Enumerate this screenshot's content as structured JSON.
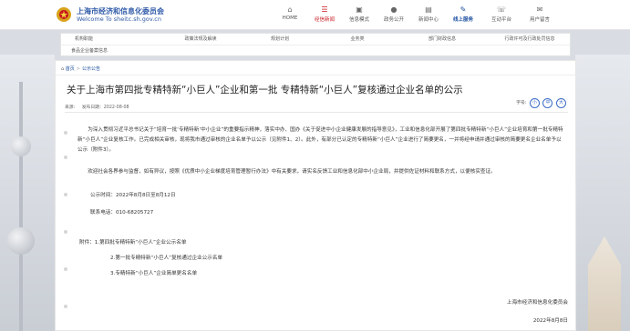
{
  "header": {
    "org_name": "上海市经济和信息化委员会",
    "org_sub": "Welcome To sheitc.sh.gov.cn",
    "nav": [
      {
        "label": "HOME",
        "icon": "home-icon",
        "glyph": "⌂"
      },
      {
        "label": "经信新闻",
        "icon": "news-icon",
        "glyph": "☰"
      },
      {
        "label": "信息模式",
        "icon": "info-icon",
        "glyph": "▣"
      },
      {
        "label": "政务公开",
        "icon": "gov-icon",
        "glyph": "●"
      },
      {
        "label": "新闻中心",
        "icon": "media-icon",
        "glyph": "▤"
      },
      {
        "label": "线上服务",
        "icon": "service-icon",
        "glyph": "✎"
      },
      {
        "label": "互动平台",
        "icon": "chat-icon",
        "glyph": "☏"
      },
      {
        "label": "用户留言",
        "icon": "message-icon",
        "glyph": "✉"
      }
    ]
  },
  "subnav": {
    "row1": [
      "机构职能",
      "政策法规及解读",
      "规划计划",
      "业务类",
      "部门财政信息",
      "行政许可及行政处罚信息"
    ],
    "row2": [
      "食品企业备案信息"
    ]
  },
  "breadcrumb": {
    "home": "首页",
    "sep": ">",
    "current": "公示公告"
  },
  "article": {
    "title": "关于上海市第四批专精特新“小巨人”企业和第一批 专精特新“小巨人”复核通过企业名单的公示",
    "source_label": "来源:",
    "date_label": "发布日期：2022-08-08",
    "fontsize_label": "字号:",
    "fontsize_small": "小",
    "fontsize_mid": "中",
    "fontsize_big": "大",
    "p1": "为深入贯彻习近平总书记关于“培育一批‘专精特新’中小企业”的重要指示精神，落实中办、国办《关于促进中小企业健康发展的指导意见》，工业和信息化部开展了第四批专精特新“小巨人”企业培育和第一批专精特新“小巨人”企业复核工作。已完成相关审核，现将我市通过审核的企业名单予以公示（见附件1、2）。此外，有部分已认定的专精特新“小巨人”企业进行了简要更名，一并将经申请并通过审核的简要更名企业名单予以公示（附件3）。",
    "p2": "欢迎社会各界参与监督，如有异议，按照《优质中小企业梯度培育管理暂行办法》中有关要求，请实名反馈工业和信息化部中小企业局，并提供佐证材料和联系方式，以便核实查证。",
    "time_line": "公示时间：2022年8月8日至8月12日",
    "phone_line": "联系电话：010-68205727",
    "attach1": "附件：1.第四批专精特新“小巨人”企业公示名单",
    "attach2": "2.第一批专精特新“小巨人”复核通过企业公示名单",
    "attach3": "3.专精特新“小巨人”企业简单更名名单",
    "sign_org": "上海市经济和信息化委员会",
    "sign_date": "2022年8月8日"
  }
}
